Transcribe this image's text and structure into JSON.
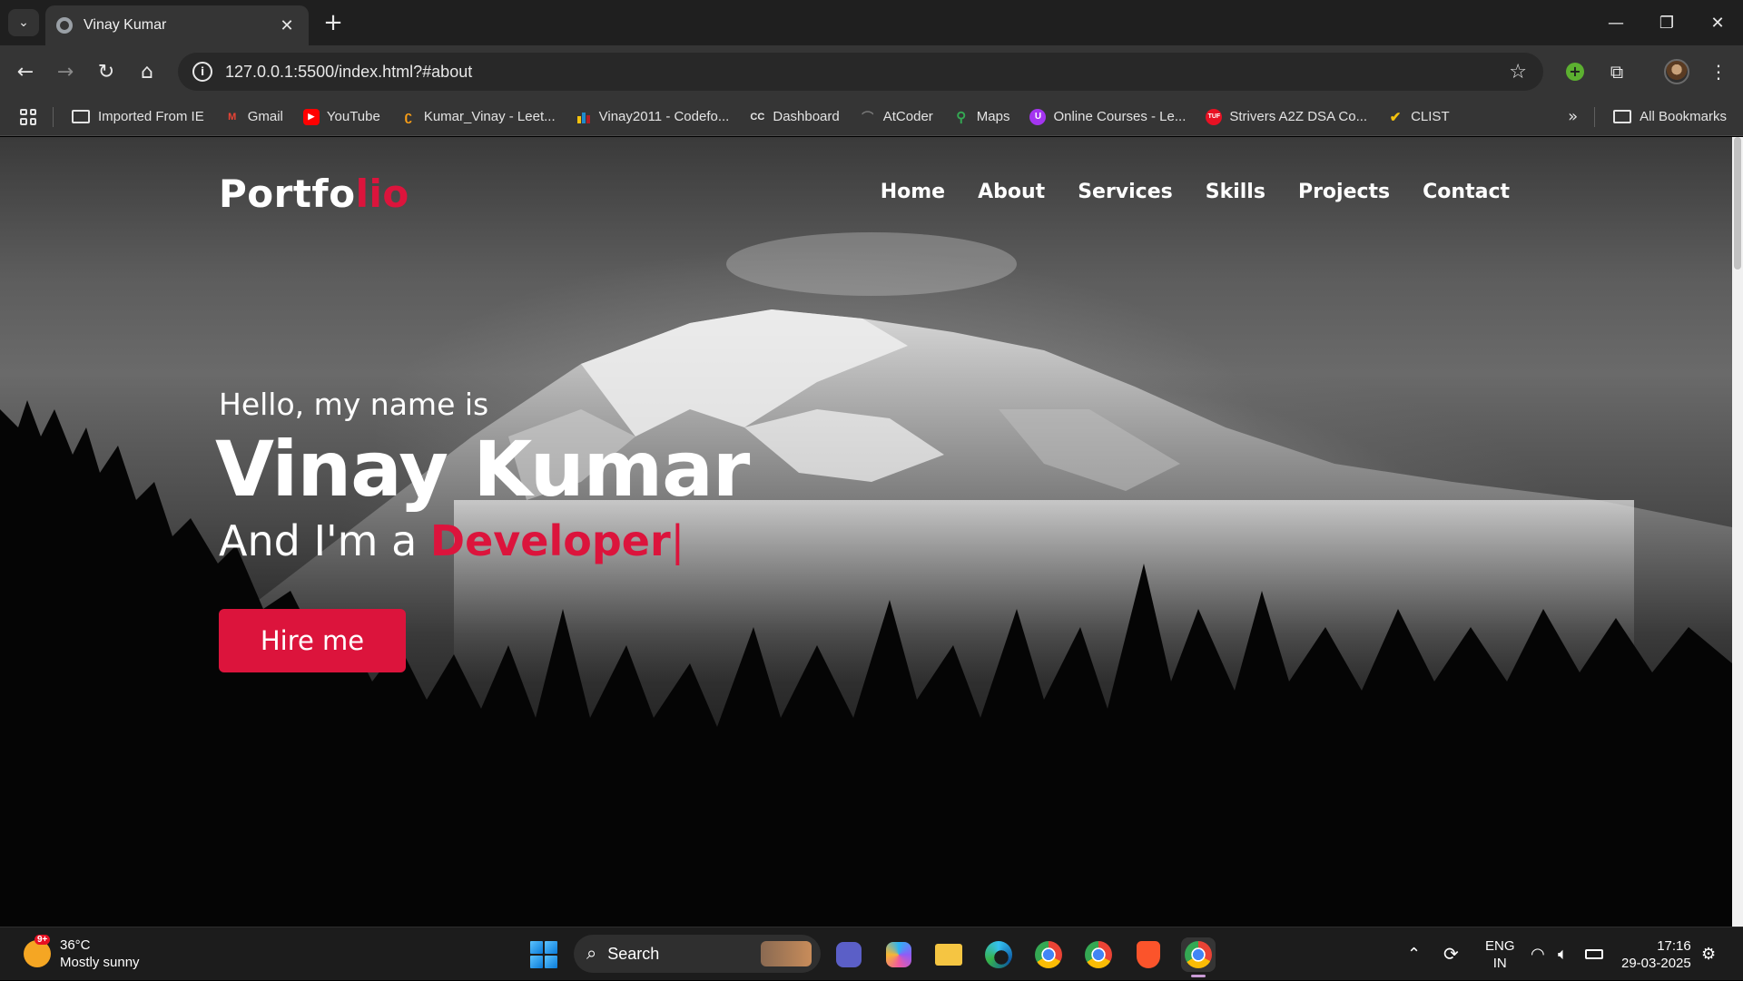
{
  "browser": {
    "tab_title": "Vinay Kumar",
    "url": "127.0.0.1:5500/index.html?#about",
    "window_controls": [
      "minimize-icon",
      "restore-icon",
      "close-icon"
    ],
    "bookmarks": [
      {
        "label": "Imported From IE",
        "icon": "folder-icon"
      },
      {
        "label": "Gmail",
        "icon": "gmail-icon",
        "color": "#ea4335"
      },
      {
        "label": "YouTube",
        "icon": "youtube-icon",
        "color": "#ff0000"
      },
      {
        "label": "Kumar_Vinay - Leet...",
        "icon": "leetcode-icon",
        "color": "#ffa116"
      },
      {
        "label": "Vinay2011 - Codefo...",
        "icon": "codeforces-icon",
        "color": "#1f8acb"
      },
      {
        "label": "Dashboard",
        "icon": "codechef-cc-icon",
        "color": "#e8e8e8"
      },
      {
        "label": "AtCoder",
        "icon": "atcoder-icon",
        "color": "#555555"
      },
      {
        "label": "Maps",
        "icon": "maps-icon",
        "color": "#34a853"
      },
      {
        "label": "Online Courses - Le...",
        "icon": "udemy-icon",
        "color": "#a435f0"
      },
      {
        "label": "Strivers A2Z DSA Co...",
        "icon": "tuf-icon",
        "color": "#e81123"
      },
      {
        "label": "CLIST",
        "icon": "clist-icon",
        "color": "#f4c20d"
      }
    ],
    "all_bookmarks_label": "All Bookmarks"
  },
  "site": {
    "logo_main": "Portfo",
    "logo_accent": "lio",
    "accent_color": "#dc143c",
    "nav": [
      "Home",
      "About",
      "Services",
      "Skills",
      "Projects",
      "Contact"
    ],
    "hello": "Hello, my name is",
    "name": "Vinay Kumar",
    "role_prefix": "And I'm a ",
    "role_typed": "Developer",
    "cursor": "|",
    "cta": "Hire me"
  },
  "taskbar": {
    "weather_temp": "36°C",
    "weather_desc": "Mostly sunny",
    "weather_badge": "9+",
    "search_placeholder": "Search",
    "lang_top": "ENG",
    "lang_bottom": "IN",
    "time": "17:16",
    "date": "29-03-2025"
  }
}
